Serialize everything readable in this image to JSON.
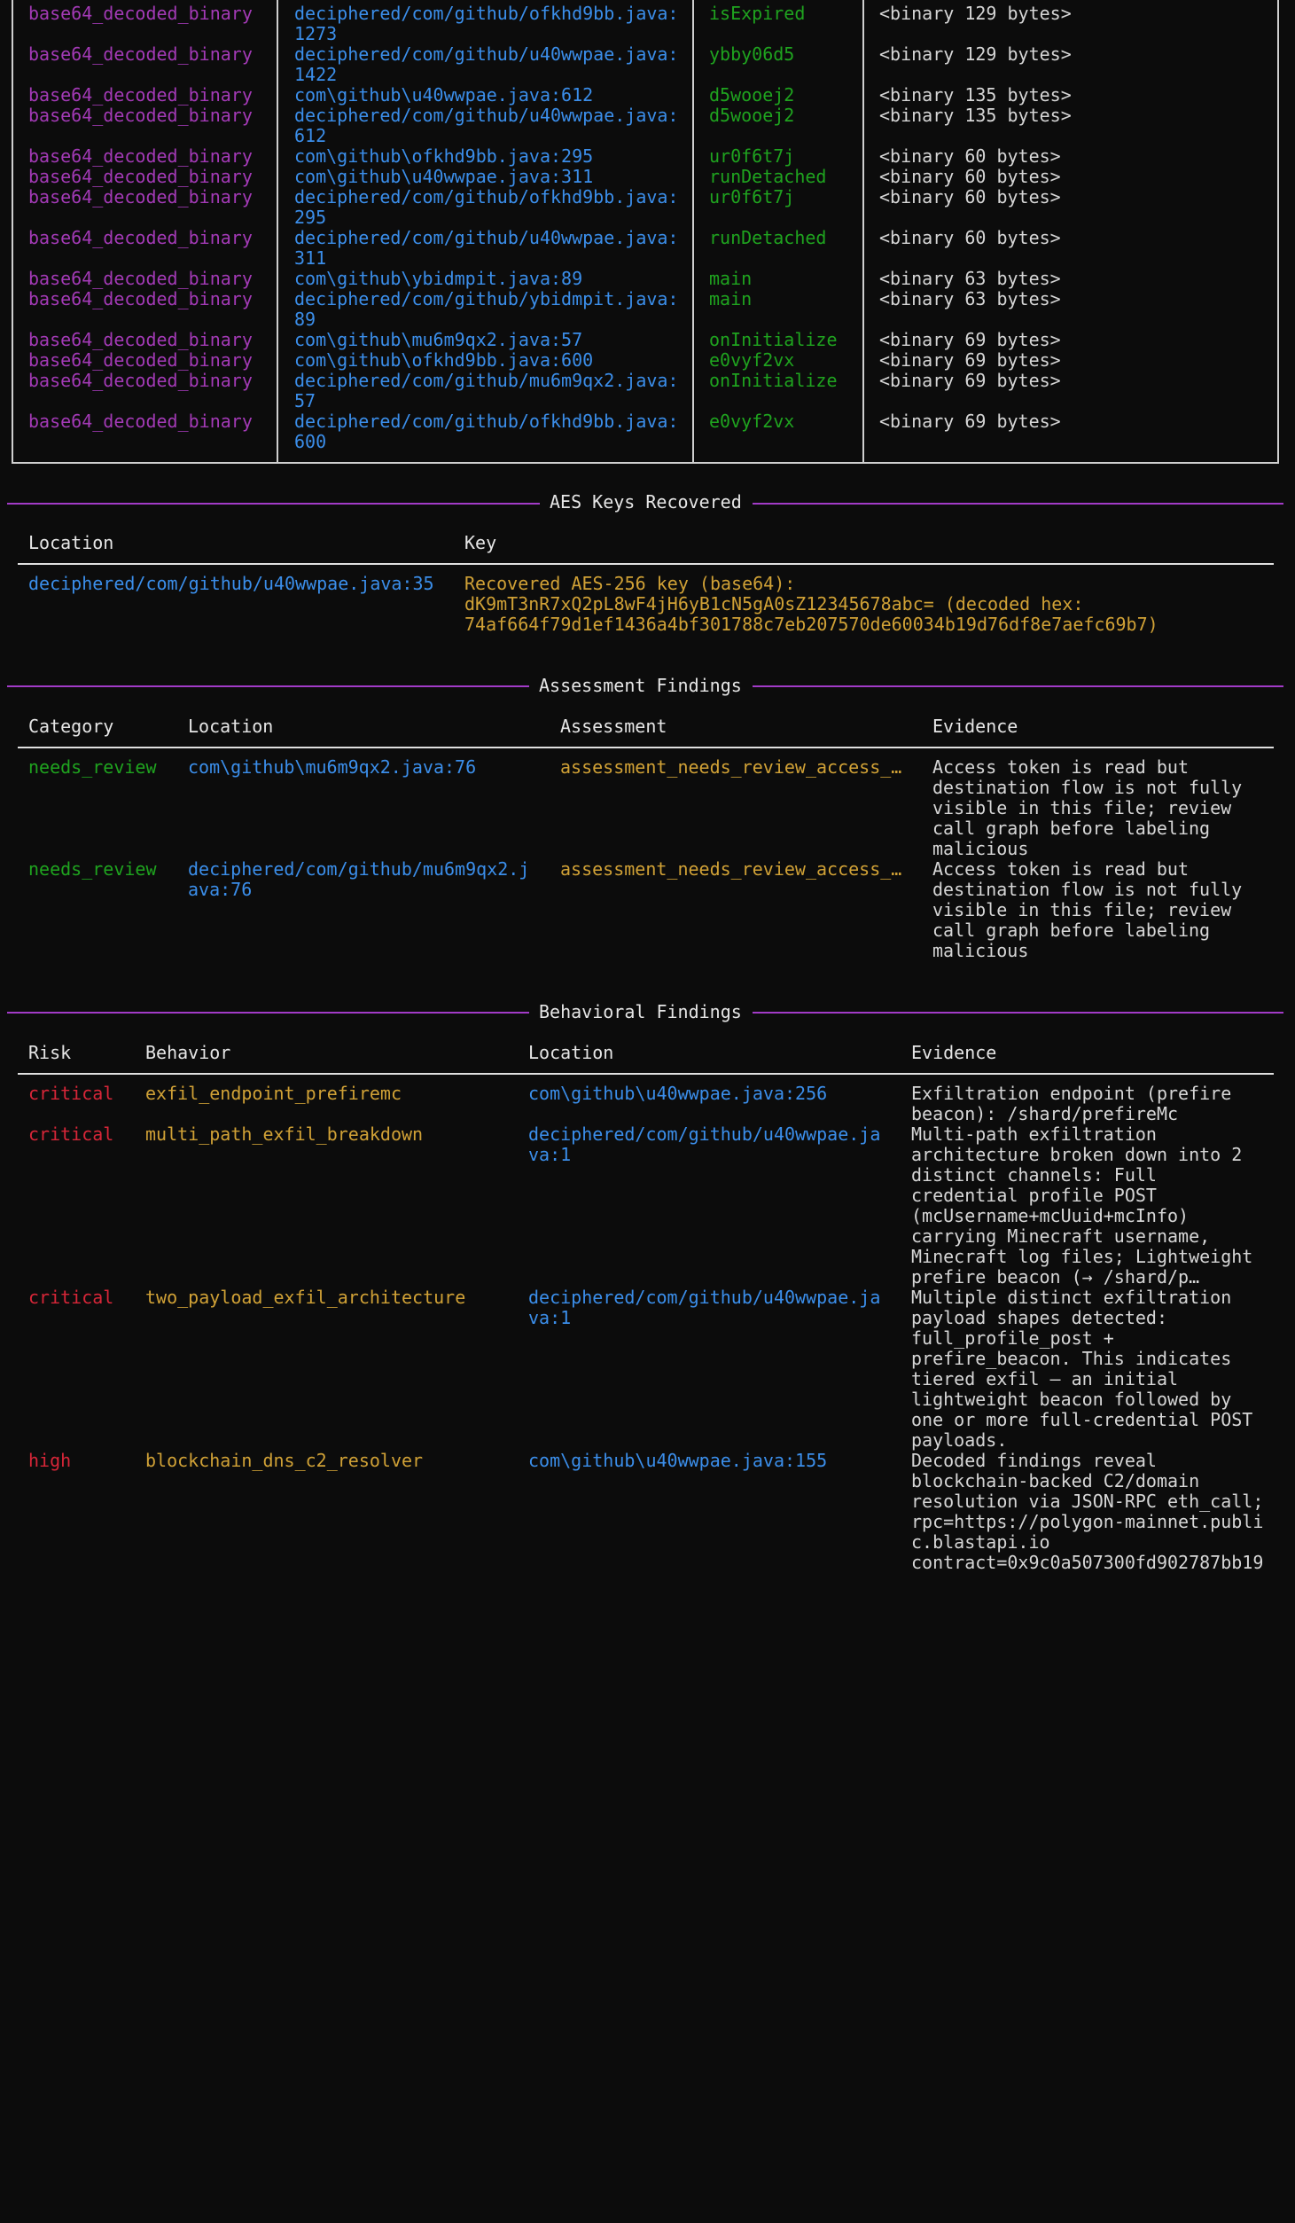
{
  "top_table": {
    "rows": [
      {
        "type": "base64_decoded_binary",
        "location": "deciphered/com/github/ofkhd9bb.java:\n1273",
        "method": "isExpired",
        "value": "<binary 129 bytes>"
      },
      {
        "type": "base64_decoded_binary",
        "location": "deciphered/com/github/u40wwpae.java:\n1422",
        "method": "ybby06d5",
        "value": "<binary 129 bytes>"
      },
      {
        "type": "base64_decoded_binary",
        "location": "com\\github\\u40wwpae.java:612",
        "method": "d5wooej2",
        "value": "<binary 135 bytes>"
      },
      {
        "type": "base64_decoded_binary",
        "location": "deciphered/com/github/u40wwpae.java:\n612",
        "method": "d5wooej2",
        "value": "<binary 135 bytes>"
      },
      {
        "type": "base64_decoded_binary",
        "location": "com\\github\\ofkhd9bb.java:295",
        "method": "ur0f6t7j",
        "value": "<binary 60 bytes>"
      },
      {
        "type": "base64_decoded_binary",
        "location": "com\\github\\u40wwpae.java:311",
        "method": "runDetached",
        "value": "<binary 60 bytes>"
      },
      {
        "type": "base64_decoded_binary",
        "location": "deciphered/com/github/ofkhd9bb.java:\n295",
        "method": "ur0f6t7j",
        "value": "<binary 60 bytes>"
      },
      {
        "type": "base64_decoded_binary",
        "location": "deciphered/com/github/u40wwpae.java:\n311",
        "method": "runDetached",
        "value": "<binary 60 bytes>"
      },
      {
        "type": "base64_decoded_binary",
        "location": "com\\github\\ybidmpit.java:89",
        "method": "main",
        "value": "<binary 63 bytes>"
      },
      {
        "type": "base64_decoded_binary",
        "location": "deciphered/com/github/ybidmpit.java:\n89",
        "method": "main",
        "value": "<binary 63 bytes>"
      },
      {
        "type": "base64_decoded_binary",
        "location": "com\\github\\mu6m9qx2.java:57",
        "method": "onInitialize",
        "value": "<binary 69 bytes>"
      },
      {
        "type": "base64_decoded_binary",
        "location": "com\\github\\ofkhd9bb.java:600",
        "method": "e0vyf2vx",
        "value": "<binary 69 bytes>"
      },
      {
        "type": "base64_decoded_binary",
        "location": "deciphered/com/github/mu6m9qx2.java:\n57",
        "method": "onInitialize",
        "value": "<binary 69 bytes>"
      },
      {
        "type": "base64_decoded_binary",
        "location": "deciphered/com/github/ofkhd9bb.java:\n600",
        "method": "e0vyf2vx",
        "value": "<binary 69 bytes>"
      }
    ]
  },
  "aes": {
    "title": "AES Keys Recovered",
    "headers": [
      "Location",
      "Key"
    ],
    "rows": [
      {
        "location": "deciphered/com/github/u40wwpae.java:35",
        "key": "Recovered AES-256 key (base64):\ndK9mT3nR7xQ2pL8wF4jH6yB1cN5gA0sZ12345678abc= (decoded hex:\n74af664f79d1ef1436a4bf301788c7eb207570de60034b19d76df8e7aefc69b7)"
      }
    ]
  },
  "assessment": {
    "title": "Assessment Findings",
    "headers": [
      "Category",
      "Location",
      "Assessment",
      "Evidence"
    ],
    "rows": [
      {
        "category": "needs_review",
        "location": "com\\github\\mu6m9qx2.java:76",
        "assessment": "assessment_needs_review_access_…",
        "evidence": "Access token is read but\ndestination flow is not fully\nvisible in this file; review\ncall graph before labeling\nmalicious"
      },
      {
        "category": "needs_review",
        "location": "deciphered/com/github/mu6m9qx2.j\nava:76",
        "assessment": "assessment_needs_review_access_…",
        "evidence": "Access token is read but\ndestination flow is not fully\nvisible in this file; review\ncall graph before labeling\nmalicious"
      }
    ]
  },
  "behavioral": {
    "title": "Behavioral Findings",
    "headers": [
      "Risk",
      "Behavior",
      "Location",
      "Evidence"
    ],
    "rows": [
      {
        "risk": "critical",
        "behavior": "exfil_endpoint_prefiremc",
        "location": "com\\github\\u40wwpae.java:256",
        "evidence": "Exfiltration endpoint (prefire\nbeacon): /shard/prefireMc"
      },
      {
        "risk": "critical",
        "behavior": "multi_path_exfil_breakdown",
        "location": "deciphered/com/github/u40wwpae.ja\nva:1",
        "evidence": "Multi-path exfiltration\narchitecture broken down into 2\ndistinct channels: Full\ncredential profile POST\n(mcUsername+mcUuid+mcInfo)\ncarrying Minecraft username,\nMinecraft log files; Lightweight\nprefire beacon (→ /shard/p…"
      },
      {
        "risk": "critical",
        "behavior": "two_payload_exfil_architecture",
        "location": "deciphered/com/github/u40wwpae.ja\nva:1",
        "evidence": "Multiple distinct exfiltration\npayload shapes detected:\nfull_profile_post +\nprefire_beacon. This indicates\ntiered exfil — an initial\nlightweight beacon followed by\none or more full-credential POST\npayloads."
      },
      {
        "risk": "high",
        "behavior": "blockchain_dns_c2_resolver",
        "location": "com\\github\\u40wwpae.java:155",
        "evidence": "Decoded findings reveal\nblockchain-backed C2/domain\nresolution via JSON-RPC eth_call;\nrpc=https://polygon-mainnet.publi\nc.blastapi.io\ncontract=0x9c0a507300fd902787bb19"
      }
    ]
  }
}
